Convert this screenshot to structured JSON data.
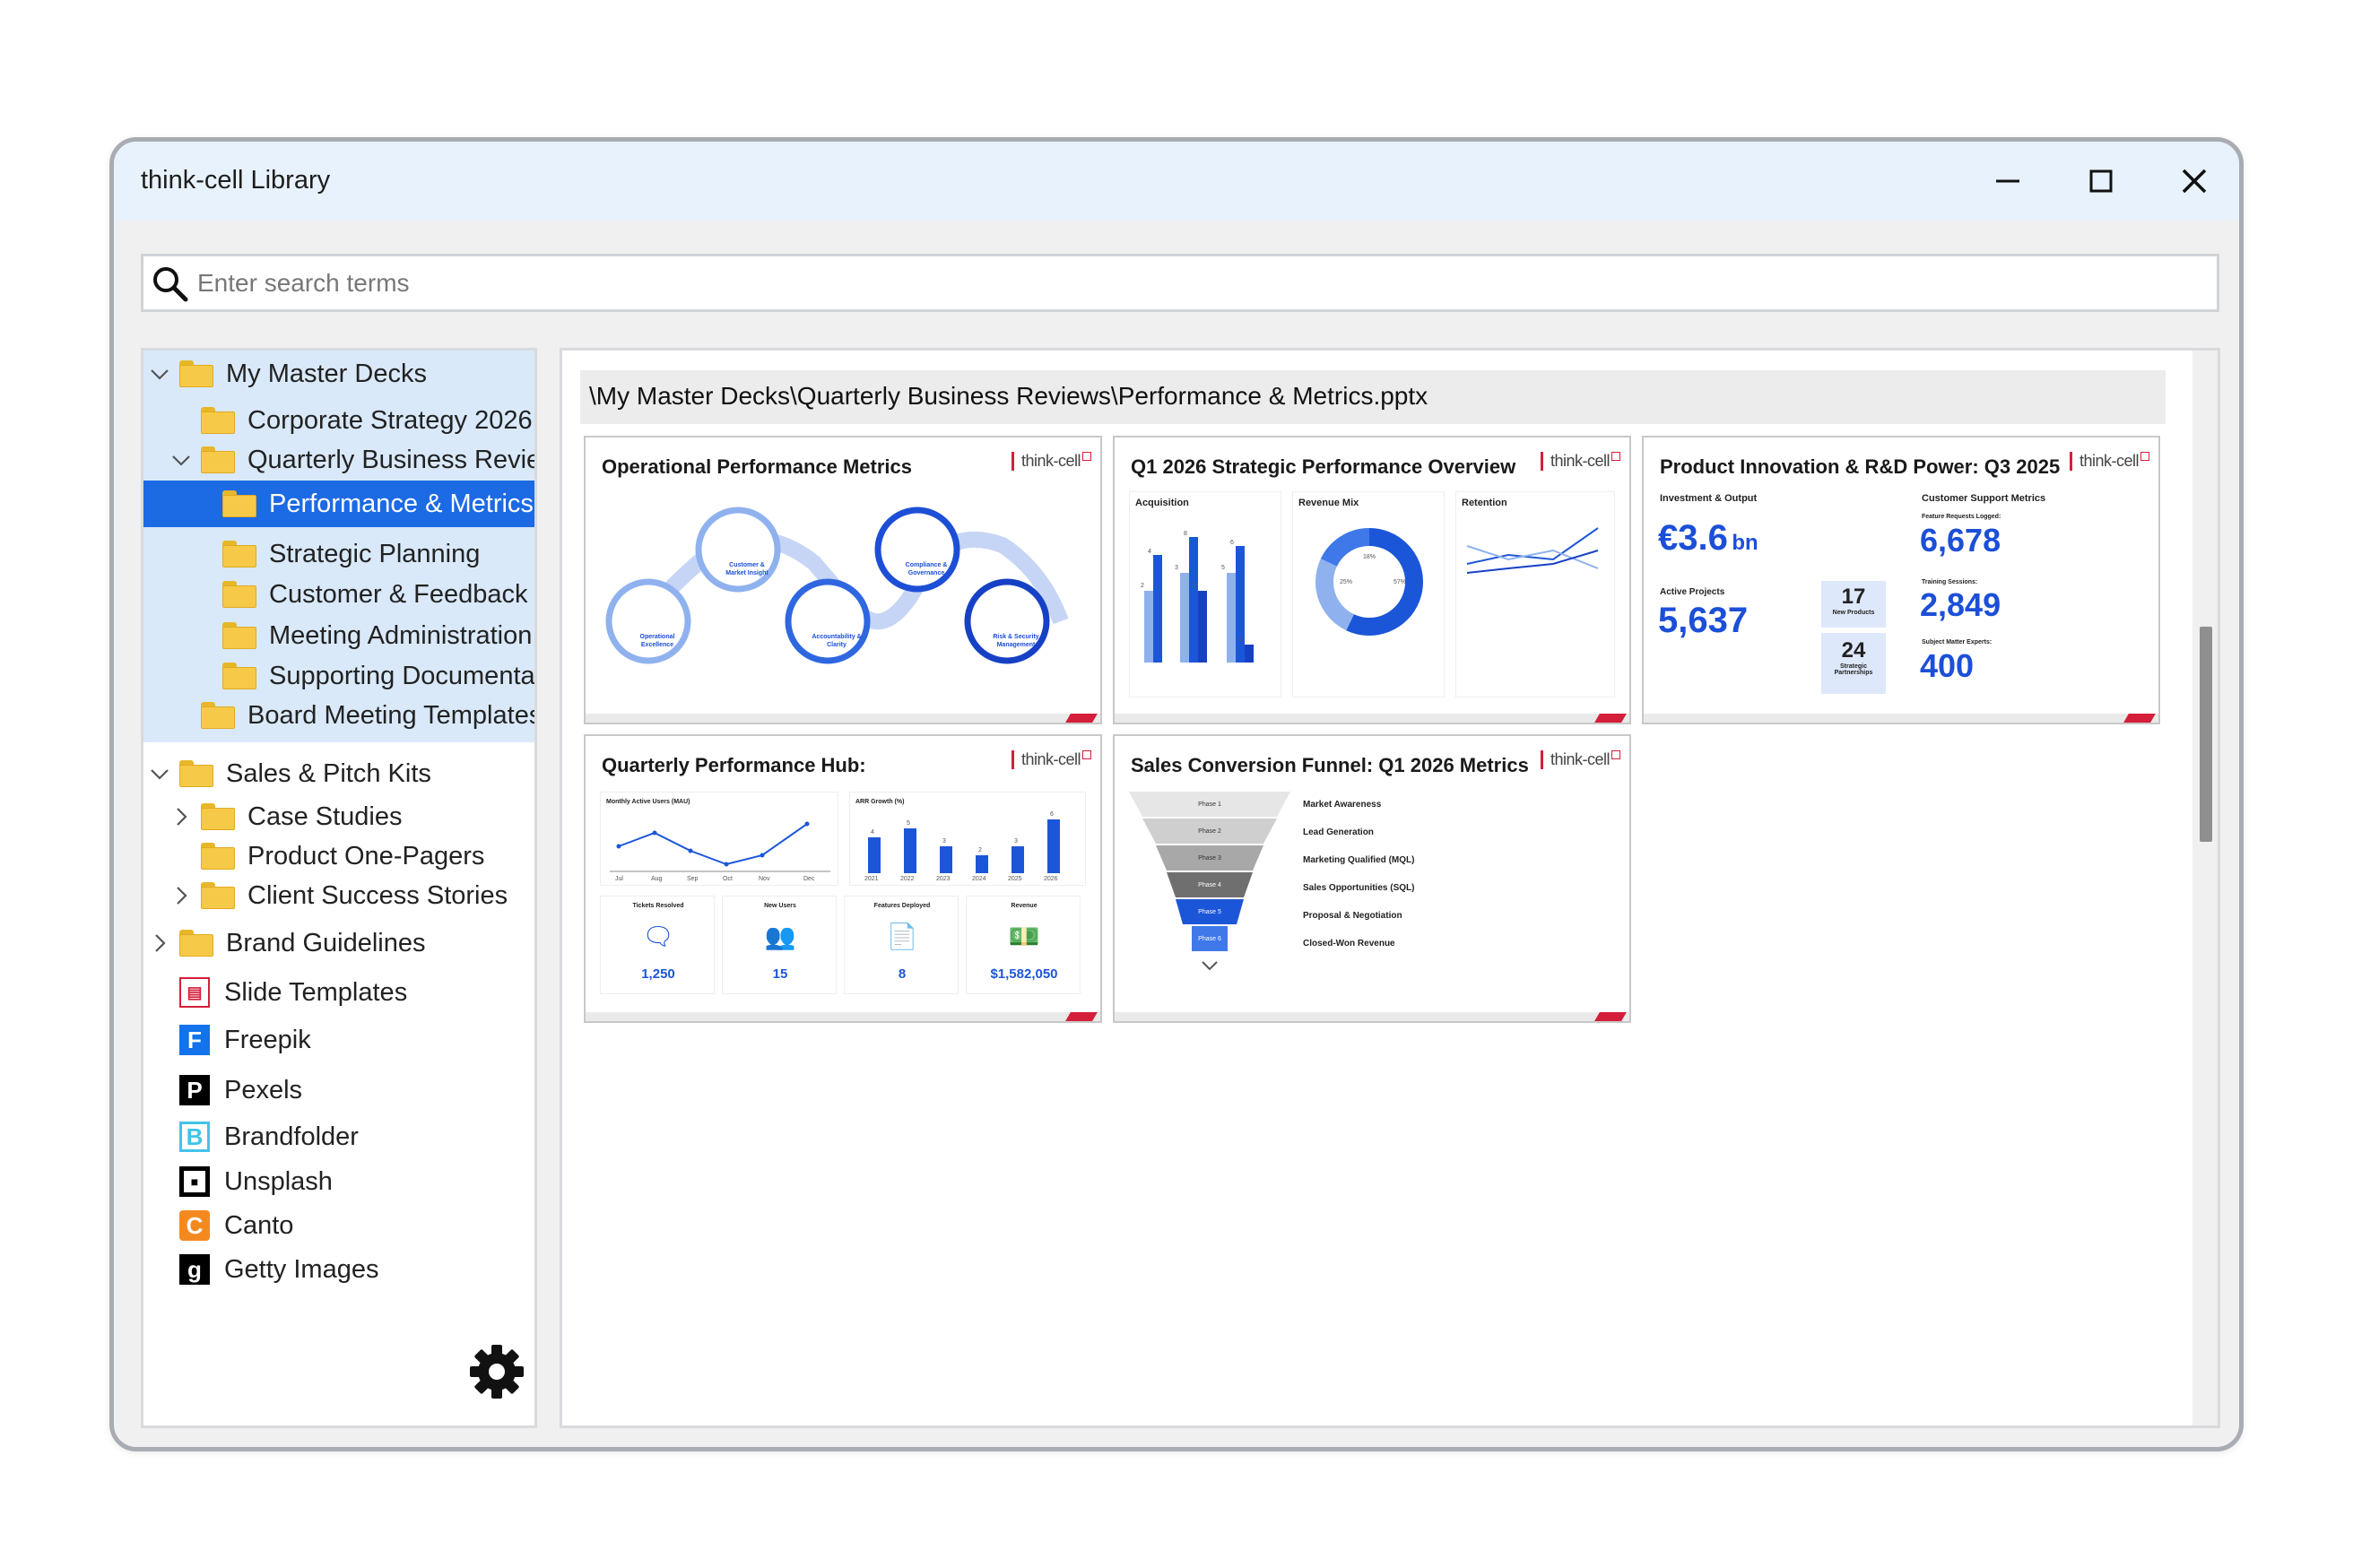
{
  "window": {
    "title": "think-cell Library",
    "minimize_icon": "minimize-icon",
    "maximize_icon": "maximize-icon",
    "close_icon": "close-icon"
  },
  "search": {
    "placeholder": "Enter search terms",
    "value": ""
  },
  "tree": {
    "items": [
      {
        "label": "My Master Decks",
        "level": 0,
        "expander": "expanded"
      },
      {
        "label": "Corporate Strategy 2026",
        "level": 1,
        "expander": "none"
      },
      {
        "label": "Quarterly Business Reviews",
        "level": 1,
        "expander": "expanded"
      },
      {
        "label": "Performance & Metrics",
        "level": 2,
        "expander": "none",
        "selected": true
      },
      {
        "label": "Strategic Planning",
        "level": 2,
        "expander": "none"
      },
      {
        "label": "Customer & Feedback",
        "level": 2,
        "expander": "none"
      },
      {
        "label": "Meeting Administration",
        "level": 2,
        "expander": "none"
      },
      {
        "label": "Supporting Documentation",
        "level": 2,
        "expander": "none"
      },
      {
        "label": "Board Meeting Templates",
        "level": 1,
        "expander": "none"
      },
      {
        "label": "Sales & Pitch Kits",
        "level": 0,
        "expander": "expanded"
      },
      {
        "label": "Case Studies",
        "level": 1,
        "expander": "collapsed"
      },
      {
        "label": "Product One-Pagers",
        "level": 1,
        "expander": "none"
      },
      {
        "label": "Client Success Stories",
        "level": 1,
        "expander": "collapsed"
      },
      {
        "label": "Brand Guidelines",
        "level": 0,
        "expander": "collapsed"
      }
    ],
    "services": [
      {
        "label": "Slide Templates",
        "icon": "slide-templates-icon",
        "color": "#d41f3a"
      },
      {
        "label": "Freepik",
        "icon": "freepik-icon",
        "color": "#1273eb"
      },
      {
        "label": "Pexels",
        "icon": "pexels-icon",
        "color": "#000000"
      },
      {
        "label": "Brandfolder",
        "icon": "brandfolder-icon",
        "color": "#40c4e8"
      },
      {
        "label": "Unsplash",
        "icon": "unsplash-icon",
        "color": "#000000"
      },
      {
        "label": "Canto",
        "icon": "canto-icon",
        "color": "#f48a1f"
      },
      {
        "label": "Getty Images",
        "icon": "getty-images-icon",
        "color": "#000000"
      }
    ],
    "settings_icon": "gear-icon"
  },
  "content": {
    "path": "\\My Master Decks\\Quarterly Business Reviews\\Performance & Metrics.pptx",
    "slides": [
      {
        "title": "Operational Performance Metrics",
        "logo": "think-cell",
        "nodes": [
          "Customer & Market Insight",
          "Compliance & Governance",
          "Operational Excellence",
          "Accountability & Clarity",
          "Risk & Security Management"
        ]
      },
      {
        "title": "Q1 2026 Strategic Performance Overview",
        "logo": "think-cell",
        "panels": [
          "Acquisition",
          "Revenue Mix",
          "Retention"
        ],
        "donut_labels": [
          "18%",
          "25%",
          "57%"
        ],
        "bar_labels": [
          "4",
          "2",
          "8",
          "3",
          "6",
          "2",
          "5",
          "1"
        ]
      },
      {
        "title": "Product Innovation & R&D Power: Q3 2025",
        "logo": "think-cell",
        "left_heading": "Investment & Output",
        "right_heading": "Customer Support Metrics",
        "invest_value": "€3.6",
        "invest_unit": "bn",
        "active_projects_label": "Active Projects",
        "active_projects": "5,637",
        "new_products": "17",
        "new_products_label": "New Products",
        "partnerships": "24",
        "partnerships_label": "Strategic Partnerships",
        "feature_requests_label": "Feature Requests Logged:",
        "feature_requests": "6,678",
        "training_label": "Training Sessions:",
        "training": "2,849",
        "experts_label": "Subject Matter Experts:",
        "experts": "400"
      },
      {
        "title": "Quarterly Performance Hub:",
        "logo": "think-cell",
        "mau_title": "Monthly Active Users (MAU)",
        "mau_months": [
          "Jul",
          "Aug",
          "Sep",
          "Oct",
          "Nov",
          "Dec"
        ],
        "arr_title": "ARR Growth (%)",
        "arr_years": [
          "2021",
          "2022",
          "2023",
          "2024",
          "2025",
          "2026"
        ],
        "arr_values": [
          "4",
          "5",
          "3",
          "2",
          "3",
          "6"
        ],
        "kpis": [
          {
            "label": "Tickets Resolved",
            "value": "1,250",
            "icon": "chat-icon"
          },
          {
            "label": "New Users",
            "value": "15",
            "icon": "users-icon"
          },
          {
            "label": "Features Deployed",
            "value": "8",
            "icon": "document-icon"
          },
          {
            "label": "Revenue",
            "value": "$1,582,050",
            "icon": "money-icon"
          }
        ]
      },
      {
        "title": "Sales Conversion Funnel: Q1 2026 Metrics",
        "logo": "think-cell",
        "phases": [
          "Phase 1",
          "Phase 2",
          "Phase 3",
          "Phase 4",
          "Phase 5",
          "Phase 6"
        ],
        "stages": [
          "Market Awareness",
          "Lead Generation",
          "Marketing Qualified (MQL)",
          "Sales Opportunities (SQL)",
          "Proposal & Negotiation",
          "Closed-Won Revenue"
        ]
      }
    ]
  }
}
